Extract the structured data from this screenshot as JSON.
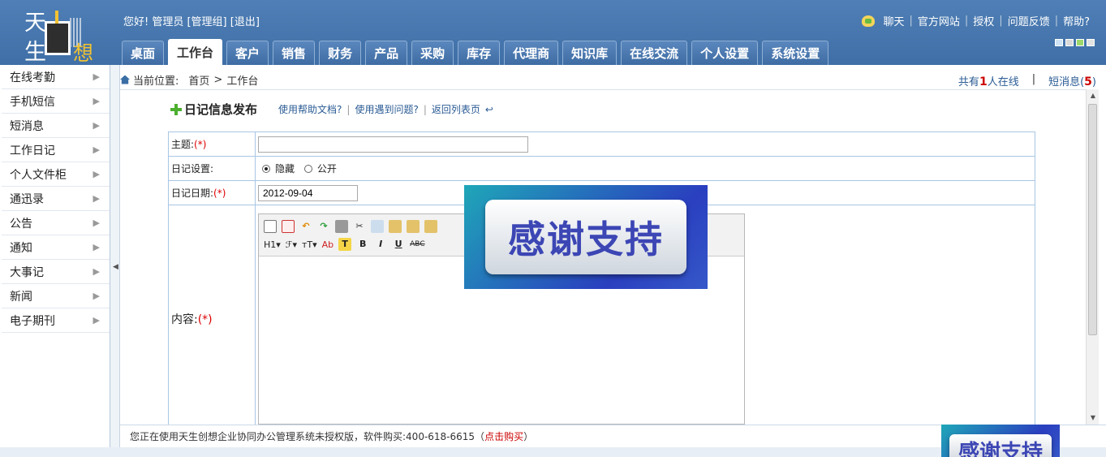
{
  "logo": {
    "chars": [
      "天",
      "生",
      "想"
    ]
  },
  "header": {
    "greeting": "您好! 管理员 [管理组] [退出]",
    "links": [
      "聊天",
      "官方网站",
      "授权",
      "问题反馈",
      "帮助?"
    ]
  },
  "nav": {
    "tabs": [
      "桌面",
      "工作台",
      "客户",
      "销售",
      "财务",
      "产品",
      "采购",
      "库存",
      "代理商",
      "知识库",
      "在线交流",
      "个人设置",
      "系统设置"
    ],
    "active": "工作台"
  },
  "theme_colors": [
    "#cfe3f5",
    "#d9d9d9",
    "#9fd86a",
    "#e2e2e2"
  ],
  "sidebar": {
    "items": [
      "在线考勤",
      "手机短信",
      "短消息",
      "工作日记",
      "个人文件柜",
      "通迅录",
      "公告",
      "通知",
      "大事记",
      "新闻",
      "电子期刊"
    ]
  },
  "breadcrumb": {
    "label": "当前位置:",
    "home": "首页",
    "sep": ">",
    "current": "工作台"
  },
  "status": {
    "online_prefix": "共有",
    "online_count": "1",
    "online_suffix": "人在线",
    "divider": "|",
    "msg_label": "短消息(",
    "msg_count": "5",
    "msg_close": ")"
  },
  "form": {
    "title": "日记信息发布",
    "links": [
      "使用帮助文档?",
      "使用遇到问题?",
      "返回列表页"
    ],
    "link_sep": "|",
    "subject_label": "主题:",
    "required": "(*)",
    "setting_label": "日记设置:",
    "radio_hidden": "隐藏",
    "radio_public": "公开",
    "date_label": "日记日期:",
    "date_value": "2012-09-04",
    "content_label": "内容:"
  },
  "editor": {
    "row2": [
      "H1▾",
      "ℱ▾",
      "тT▾",
      "Ab",
      "T",
      "B",
      "I",
      "U",
      "ABC"
    ]
  },
  "watermark": {
    "text": "感谢支持"
  },
  "footer": {
    "text": "您正在使用天生创想企业协同办公管理系统未授权版，软件购买:400-618-6615（",
    "buy": "点击购买",
    "close": "）"
  }
}
